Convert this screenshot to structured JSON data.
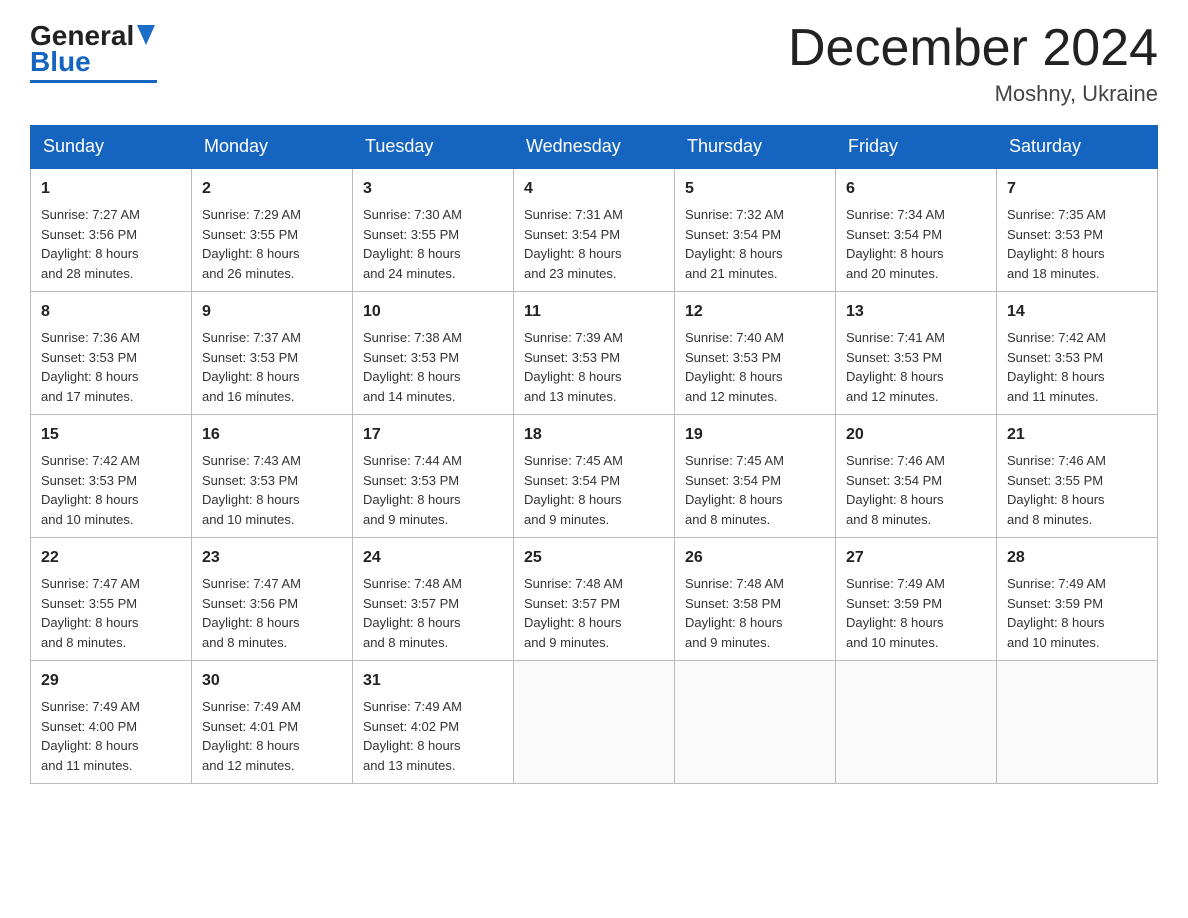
{
  "logo": {
    "general": "General",
    "blue": "Blue"
  },
  "header": {
    "title": "December 2024",
    "subtitle": "Moshny, Ukraine"
  },
  "days_of_week": [
    "Sunday",
    "Monday",
    "Tuesday",
    "Wednesday",
    "Thursday",
    "Friday",
    "Saturday"
  ],
  "weeks": [
    [
      {
        "day": "1",
        "sunrise": "Sunrise: 7:27 AM",
        "sunset": "Sunset: 3:56 PM",
        "daylight": "Daylight: 8 hours",
        "daylight2": "and 28 minutes."
      },
      {
        "day": "2",
        "sunrise": "Sunrise: 7:29 AM",
        "sunset": "Sunset: 3:55 PM",
        "daylight": "Daylight: 8 hours",
        "daylight2": "and 26 minutes."
      },
      {
        "day": "3",
        "sunrise": "Sunrise: 7:30 AM",
        "sunset": "Sunset: 3:55 PM",
        "daylight": "Daylight: 8 hours",
        "daylight2": "and 24 minutes."
      },
      {
        "day": "4",
        "sunrise": "Sunrise: 7:31 AM",
        "sunset": "Sunset: 3:54 PM",
        "daylight": "Daylight: 8 hours",
        "daylight2": "and 23 minutes."
      },
      {
        "day": "5",
        "sunrise": "Sunrise: 7:32 AM",
        "sunset": "Sunset: 3:54 PM",
        "daylight": "Daylight: 8 hours",
        "daylight2": "and 21 minutes."
      },
      {
        "day": "6",
        "sunrise": "Sunrise: 7:34 AM",
        "sunset": "Sunset: 3:54 PM",
        "daylight": "Daylight: 8 hours",
        "daylight2": "and 20 minutes."
      },
      {
        "day": "7",
        "sunrise": "Sunrise: 7:35 AM",
        "sunset": "Sunset: 3:53 PM",
        "daylight": "Daylight: 8 hours",
        "daylight2": "and 18 minutes."
      }
    ],
    [
      {
        "day": "8",
        "sunrise": "Sunrise: 7:36 AM",
        "sunset": "Sunset: 3:53 PM",
        "daylight": "Daylight: 8 hours",
        "daylight2": "and 17 minutes."
      },
      {
        "day": "9",
        "sunrise": "Sunrise: 7:37 AM",
        "sunset": "Sunset: 3:53 PM",
        "daylight": "Daylight: 8 hours",
        "daylight2": "and 16 minutes."
      },
      {
        "day": "10",
        "sunrise": "Sunrise: 7:38 AM",
        "sunset": "Sunset: 3:53 PM",
        "daylight": "Daylight: 8 hours",
        "daylight2": "and 14 minutes."
      },
      {
        "day": "11",
        "sunrise": "Sunrise: 7:39 AM",
        "sunset": "Sunset: 3:53 PM",
        "daylight": "Daylight: 8 hours",
        "daylight2": "and 13 minutes."
      },
      {
        "day": "12",
        "sunrise": "Sunrise: 7:40 AM",
        "sunset": "Sunset: 3:53 PM",
        "daylight": "Daylight: 8 hours",
        "daylight2": "and 12 minutes."
      },
      {
        "day": "13",
        "sunrise": "Sunrise: 7:41 AM",
        "sunset": "Sunset: 3:53 PM",
        "daylight": "Daylight: 8 hours",
        "daylight2": "and 12 minutes."
      },
      {
        "day": "14",
        "sunrise": "Sunrise: 7:42 AM",
        "sunset": "Sunset: 3:53 PM",
        "daylight": "Daylight: 8 hours",
        "daylight2": "and 11 minutes."
      }
    ],
    [
      {
        "day": "15",
        "sunrise": "Sunrise: 7:42 AM",
        "sunset": "Sunset: 3:53 PM",
        "daylight": "Daylight: 8 hours",
        "daylight2": "and 10 minutes."
      },
      {
        "day": "16",
        "sunrise": "Sunrise: 7:43 AM",
        "sunset": "Sunset: 3:53 PM",
        "daylight": "Daylight: 8 hours",
        "daylight2": "and 10 minutes."
      },
      {
        "day": "17",
        "sunrise": "Sunrise: 7:44 AM",
        "sunset": "Sunset: 3:53 PM",
        "daylight": "Daylight: 8 hours",
        "daylight2": "and 9 minutes."
      },
      {
        "day": "18",
        "sunrise": "Sunrise: 7:45 AM",
        "sunset": "Sunset: 3:54 PM",
        "daylight": "Daylight: 8 hours",
        "daylight2": "and 9 minutes."
      },
      {
        "day": "19",
        "sunrise": "Sunrise: 7:45 AM",
        "sunset": "Sunset: 3:54 PM",
        "daylight": "Daylight: 8 hours",
        "daylight2": "and 8 minutes."
      },
      {
        "day": "20",
        "sunrise": "Sunrise: 7:46 AM",
        "sunset": "Sunset: 3:54 PM",
        "daylight": "Daylight: 8 hours",
        "daylight2": "and 8 minutes."
      },
      {
        "day": "21",
        "sunrise": "Sunrise: 7:46 AM",
        "sunset": "Sunset: 3:55 PM",
        "daylight": "Daylight: 8 hours",
        "daylight2": "and 8 minutes."
      }
    ],
    [
      {
        "day": "22",
        "sunrise": "Sunrise: 7:47 AM",
        "sunset": "Sunset: 3:55 PM",
        "daylight": "Daylight: 8 hours",
        "daylight2": "and 8 minutes."
      },
      {
        "day": "23",
        "sunrise": "Sunrise: 7:47 AM",
        "sunset": "Sunset: 3:56 PM",
        "daylight": "Daylight: 8 hours",
        "daylight2": "and 8 minutes."
      },
      {
        "day": "24",
        "sunrise": "Sunrise: 7:48 AM",
        "sunset": "Sunset: 3:57 PM",
        "daylight": "Daylight: 8 hours",
        "daylight2": "and 8 minutes."
      },
      {
        "day": "25",
        "sunrise": "Sunrise: 7:48 AM",
        "sunset": "Sunset: 3:57 PM",
        "daylight": "Daylight: 8 hours",
        "daylight2": "and 9 minutes."
      },
      {
        "day": "26",
        "sunrise": "Sunrise: 7:48 AM",
        "sunset": "Sunset: 3:58 PM",
        "daylight": "Daylight: 8 hours",
        "daylight2": "and 9 minutes."
      },
      {
        "day": "27",
        "sunrise": "Sunrise: 7:49 AM",
        "sunset": "Sunset: 3:59 PM",
        "daylight": "Daylight: 8 hours",
        "daylight2": "and 10 minutes."
      },
      {
        "day": "28",
        "sunrise": "Sunrise: 7:49 AM",
        "sunset": "Sunset: 3:59 PM",
        "daylight": "Daylight: 8 hours",
        "daylight2": "and 10 minutes."
      }
    ],
    [
      {
        "day": "29",
        "sunrise": "Sunrise: 7:49 AM",
        "sunset": "Sunset: 4:00 PM",
        "daylight": "Daylight: 8 hours",
        "daylight2": "and 11 minutes."
      },
      {
        "day": "30",
        "sunrise": "Sunrise: 7:49 AM",
        "sunset": "Sunset: 4:01 PM",
        "daylight": "Daylight: 8 hours",
        "daylight2": "and 12 minutes."
      },
      {
        "day": "31",
        "sunrise": "Sunrise: 7:49 AM",
        "sunset": "Sunset: 4:02 PM",
        "daylight": "Daylight: 8 hours",
        "daylight2": "and 13 minutes."
      },
      null,
      null,
      null,
      null
    ]
  ]
}
